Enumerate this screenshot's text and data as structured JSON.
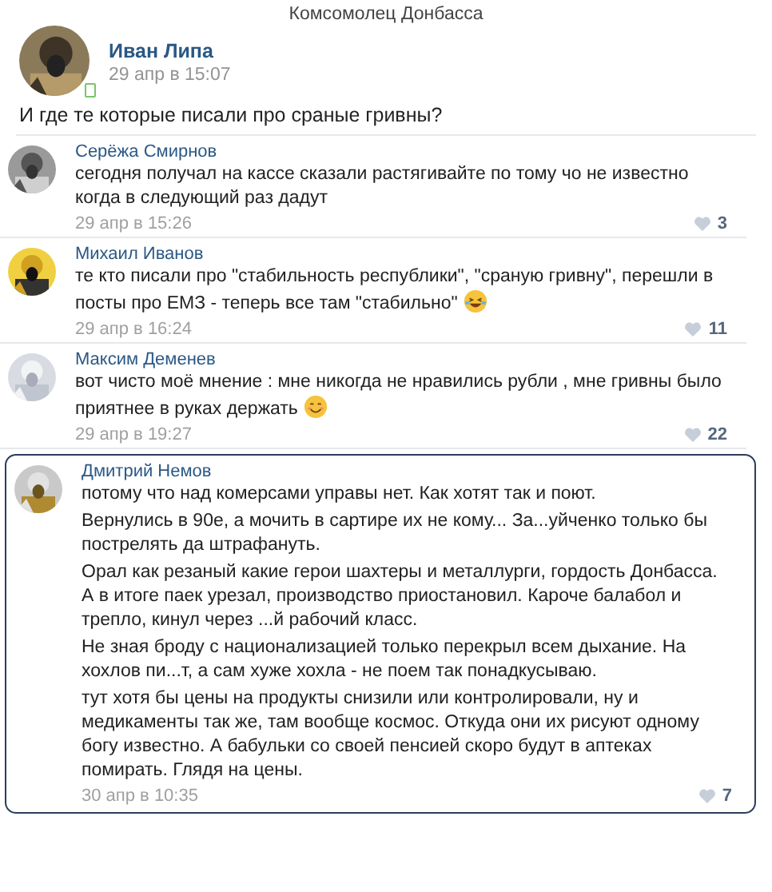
{
  "header": {
    "title": "Комсомолец Донбасса"
  },
  "post": {
    "author": "Иван Липа",
    "date": "29 апр в 15:07",
    "online_mobile": true,
    "text": "И где те которые писали про сраные гривны?"
  },
  "comments": [
    {
      "author": "Серёжа Смирнов",
      "paragraphs": [
        "сегодня получал на кассе сказали растягивайте по тому чо не известно когда в следующий раз дадут"
      ],
      "kind": "plain",
      "date": "29 апр в 15:26",
      "likes": "3",
      "highlighted": false
    },
    {
      "author": "Михаил Иванов",
      "paragraphs": [
        "те кто писали про \"стабильность республики\", \"сраную гривну\", перешли в посты про ЕМЗ - теперь все там \"стабильно\""
      ],
      "kind": "laughing",
      "date": "29 апр в 16:24",
      "likes": "11",
      "highlighted": false
    },
    {
      "author": "Максим Деменев",
      "paragraphs": [
        "вот чисто моё мнение : мне никогда не нравились рубли , мне гривны было приятнее в руках держать"
      ],
      "kind": "smile",
      "date": "29 апр в 19:27",
      "likes": "22",
      "highlighted": false
    },
    {
      "author": "Дмитрий Немов",
      "paragraphs": [
        " потому что над комерсами управы нет. Как хотят так и поют.",
        "Вернулись в 90е, а мочить в сартире их не кому... За...уйченко только бы пострелять да штрафануть.",
        "Орал как резаный какие герои шахтеры и металлурги, гордость Донбасса. А в итоге паек урезал, производство приостановил. Кароче балабол и трепло, кинул через ...й рабочий класс.",
        "Не зная броду с национализацией только перекрыл всем дыхание. На хохлов пи...т, а сам хуже хохла - не поем так понадкусываю.",
        "тут хотя бы цены на продукты снизили или контролировали, ну и медикаменты так же, там вообще космос. Откуда они их рисуют одному богу известно. А бабульки со своей пенсией скоро будут в аптеках помирать. Глядя на цены."
      ],
      "kind": "plain",
      "date": "30 апр в 10:35",
      "likes": "7",
      "highlighted": true
    }
  ]
}
